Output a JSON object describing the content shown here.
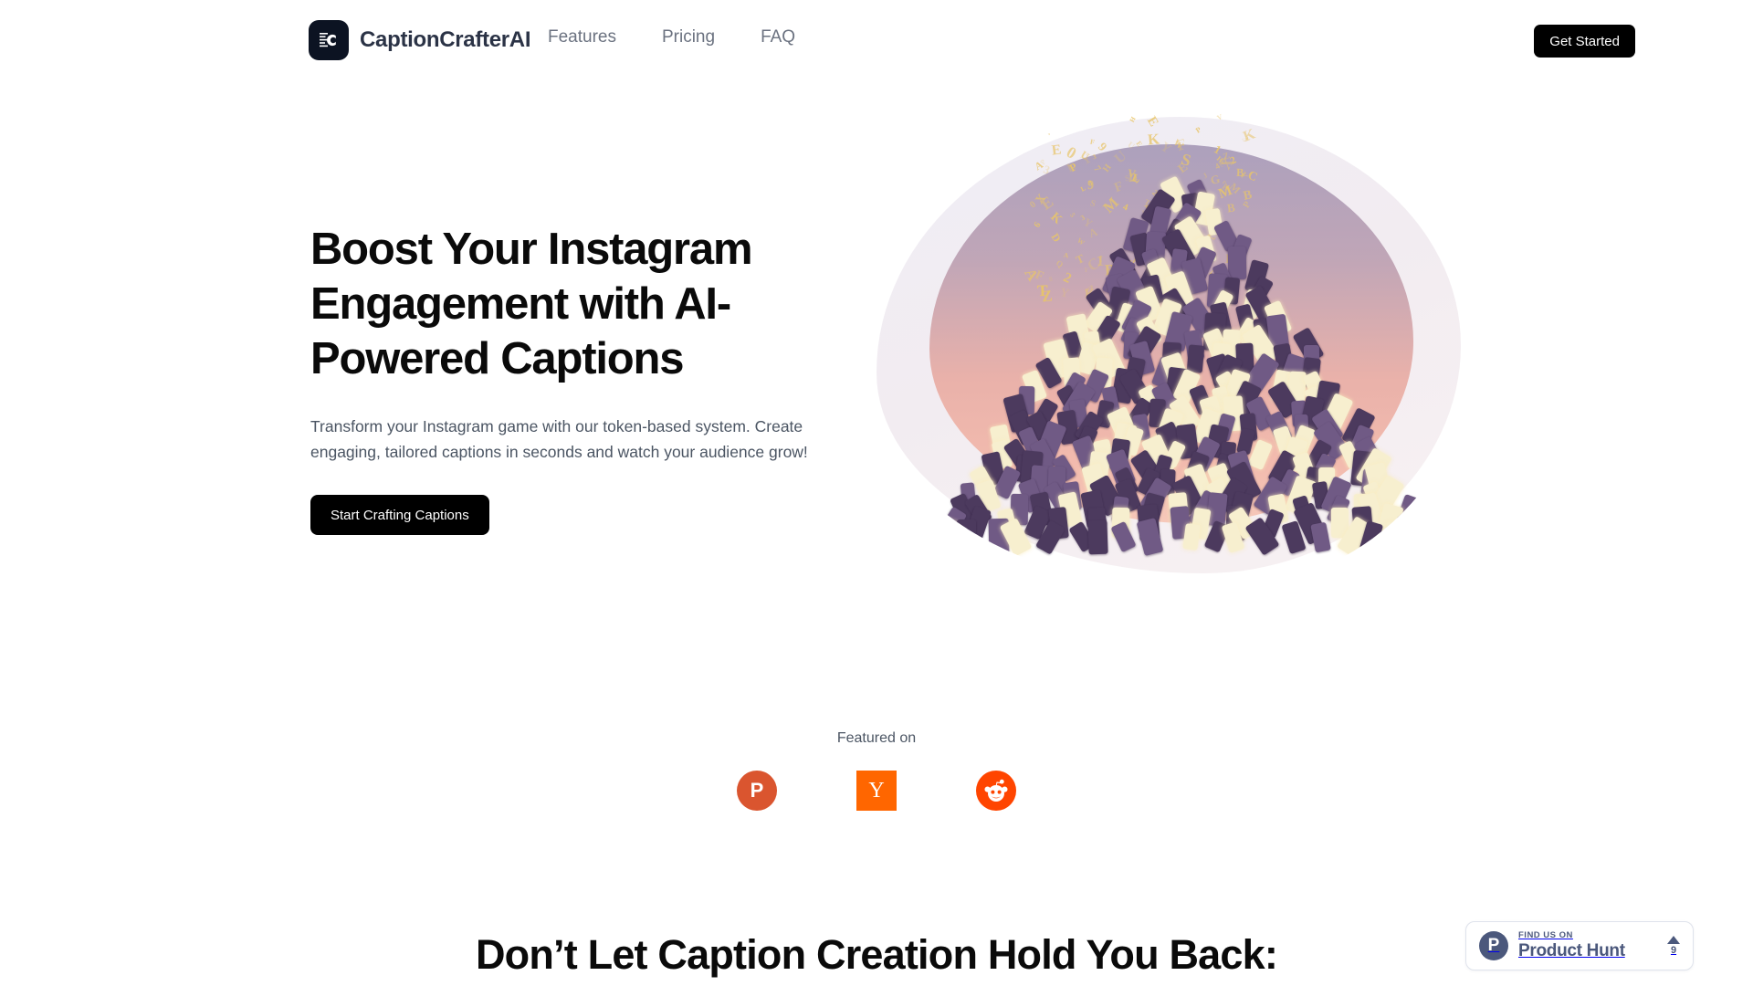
{
  "nav": {
    "brand_name": "CaptionCrafterAI",
    "brand_logo_icon": "caption-crafter-logo-icon",
    "links": [
      {
        "label": "Features"
      },
      {
        "label": "Pricing"
      },
      {
        "label": "FAQ"
      }
    ],
    "cta_label": "Get Started"
  },
  "hero": {
    "title": "Boost Your Instagram Engagement with AI-Powered Captions",
    "subtitle": "Transform your Instagram game with our token-based system. Create engaging, tailored captions in seconds and watch your audience grow!",
    "cta_label": "Start Crafting Captions",
    "illustration_name": "mountain-of-glowing-smartphones-illustration"
  },
  "featured": {
    "label": "Featured on",
    "logos": [
      {
        "name": "product-hunt",
        "glyph": "P"
      },
      {
        "name": "hacker-news",
        "glyph": "Y"
      },
      {
        "name": "reddit",
        "glyph": ""
      }
    ]
  },
  "section": {
    "heading": "Don’t Let Caption Creation Hold You Back:"
  },
  "product_hunt_widget": {
    "kicker": "FIND US ON",
    "title": "Product Hunt",
    "icon_glyph": "P",
    "vote_count": "9"
  },
  "colors": {
    "text_dark": "#0a0a0a",
    "text_muted": "#4b5563",
    "nav_link": "#6b7280",
    "brand": "#2b3346",
    "button_bg": "#000000",
    "product_hunt": "#da552f",
    "hacker_news": "#ff6600",
    "reddit": "#ff4500",
    "ph_widget": "#4b587c",
    "background": "#ffffff"
  }
}
